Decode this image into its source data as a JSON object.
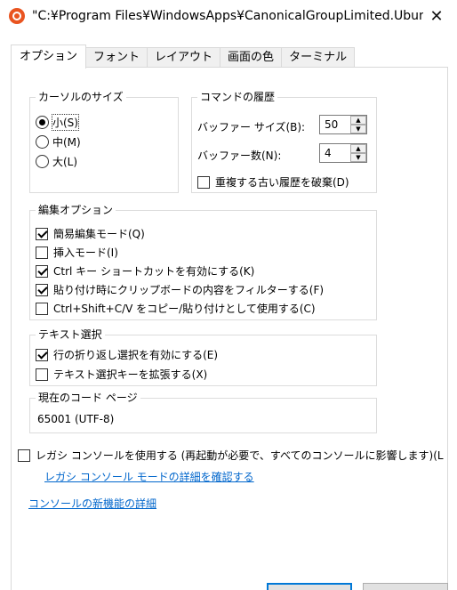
{
  "window": {
    "title": "\"C:¥Program Files¥WindowsApps¥CanonicalGroupLimited.Ubunt...",
    "close_glyph": "✕"
  },
  "tabs": [
    {
      "label": "オプション"
    },
    {
      "label": "フォント"
    },
    {
      "label": "レイアウト"
    },
    {
      "label": "画面の色"
    },
    {
      "label": "ターミナル"
    }
  ],
  "cursor_size": {
    "title": "カーソルのサイズ",
    "options": [
      {
        "label": "小(S)",
        "checked": true
      },
      {
        "label": "中(M)",
        "checked": false
      },
      {
        "label": "大(L)",
        "checked": false
      }
    ]
  },
  "history": {
    "title": "コマンドの履歴",
    "buffer_size_label": "バッファー サイズ(B):",
    "buffer_size_value": "50",
    "buffer_count_label": "バッファー数(N):",
    "buffer_count_value": "4",
    "discard_dup_label": "重複する古い履歴を破棄(D)"
  },
  "edit_options": {
    "title": "編集オプション",
    "items": [
      {
        "label": "簡易編集モード(Q)",
        "checked": true
      },
      {
        "label": "挿入モード(I)",
        "checked": false
      },
      {
        "label": "Ctrl キー ショートカットを有効にする(K)",
        "checked": true
      },
      {
        "label": "貼り付け時にクリップボードの内容をフィルターする(F)",
        "checked": true
      },
      {
        "label": "Ctrl+Shift+C/V をコピー/貼り付けとして使用する(C)",
        "checked": false
      }
    ]
  },
  "text_select": {
    "title": "テキスト選択",
    "items": [
      {
        "label": "行の折り返し選択を有効にする(E)",
        "checked": true
      },
      {
        "label": "テキスト選択キーを拡張する(X)",
        "checked": false
      }
    ]
  },
  "codepage": {
    "title": "現在のコード ページ",
    "value": "65001 (UTF-8)"
  },
  "legacy": {
    "label": "レガシ コンソールを使用する (再起動が必要で、すべてのコンソールに影響します)(L",
    "link": "レガシ コンソール モードの詳細を確認する"
  },
  "new_features_link": "コンソールの新機能の詳細",
  "colors": {
    "accent": "#0078d7",
    "link": "#0066cc",
    "ubuntu": "#e95420"
  }
}
